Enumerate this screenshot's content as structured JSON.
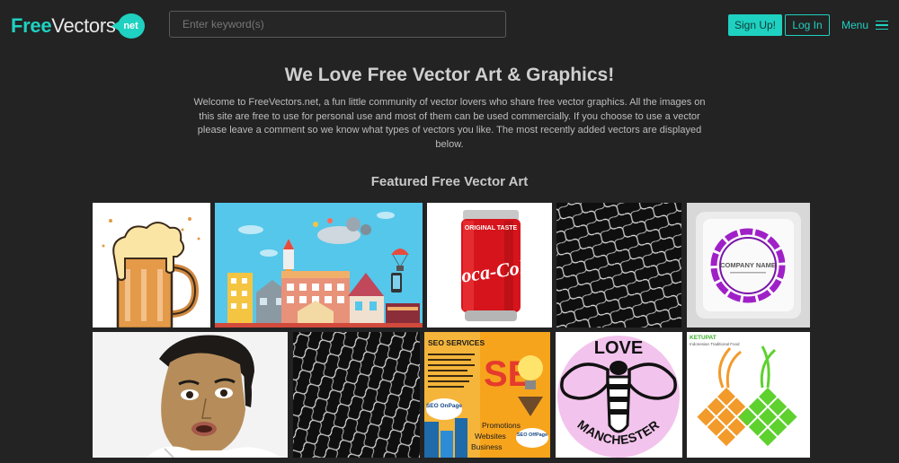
{
  "header": {
    "logo": {
      "free": "Free",
      "vectors": "Vectors",
      "badge": "net"
    },
    "search_placeholder": "Enter keyword(s)",
    "signup_label": "Sign Up!",
    "login_label": "Log In",
    "menu_label": "Menu"
  },
  "hero": {
    "title": "We Love Free Vector Art & Graphics!",
    "text": "Welcome to FreeVectors.net, a fun little community of vector lovers who share free vector graphics. All the images on this site are free to use for personal use and most of them can be used commercially. If you choose to use a vector please leave a comment so we know what types of vectors you like. The most recently added vectors are displayed below."
  },
  "featured": {
    "title": "Featured Free Vector Art",
    "tiles": {
      "coke": {
        "label": "ORIGINAL TASTE",
        "brand": "Coca-Cola"
      },
      "company": {
        "label": "COMPANY NAME"
      },
      "seo": {
        "title": "SEO SERVICES",
        "onpage": "SEO OnPage",
        "offpage": "SEO OffPage",
        "items": [
          "Promotions",
          "Websites",
          "Business"
        ]
      },
      "love": {
        "top": "LOVE",
        "bottom": "MANCHESTER"
      },
      "ketupat": {
        "title": "KETUPAT",
        "subtitle": "Indonesian Traditional Food"
      }
    }
  },
  "colors": {
    "accent": "#1fd1c1",
    "background": "#232323"
  }
}
